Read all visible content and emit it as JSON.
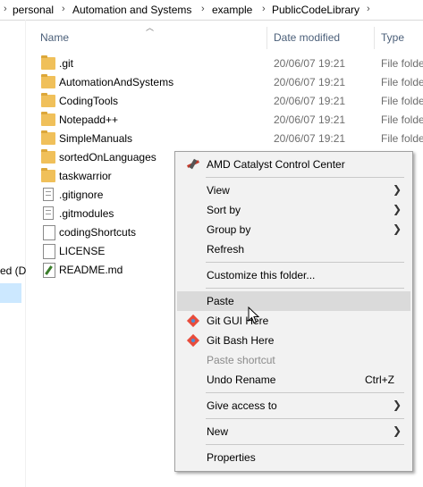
{
  "breadcrumb": {
    "items": [
      "personal",
      "Automation and Systems",
      "example",
      "PublicCodeLibrary"
    ]
  },
  "nav": {
    "fragment_text": "ed (D"
  },
  "columns": {
    "name": "Name",
    "date_modified": "Date modified",
    "type": "Type"
  },
  "files": [
    {
      "name": ".git",
      "date": "20/06/07 19:21",
      "type": "File folder",
      "kind": "folder"
    },
    {
      "name": "AutomationAndSystems",
      "date": "20/06/07 19:21",
      "type": "File folder",
      "kind": "folder"
    },
    {
      "name": "CodingTools",
      "date": "20/06/07 19:21",
      "type": "File folder",
      "kind": "folder"
    },
    {
      "name": "Notepadd++",
      "date": "20/06/07 19:21",
      "type": "File folder",
      "kind": "folder"
    },
    {
      "name": "SimpleManuals",
      "date": "20/06/07 19:21",
      "type": "File folder",
      "kind": "folder"
    },
    {
      "name": "sortedOnLanguages",
      "date": "",
      "type": "",
      "kind": "folder"
    },
    {
      "name": "taskwarrior",
      "date": "",
      "type": "",
      "kind": "folder"
    },
    {
      "name": ".gitignore",
      "date": "",
      "type": "",
      "kind": "text-file"
    },
    {
      "name": ".gitmodules",
      "date": "",
      "type": "",
      "kind": "text-file"
    },
    {
      "name": "codingShortcuts",
      "date": "",
      "type": "",
      "kind": "file"
    },
    {
      "name": "LICENSE",
      "date": "",
      "type": "",
      "kind": "file"
    },
    {
      "name": "README.md",
      "date": "",
      "type": "",
      "kind": "markdown-file"
    }
  ],
  "context_menu": {
    "items": [
      {
        "label": "AMD Catalyst Control Center",
        "icon": "amd-icon"
      },
      {
        "label": "View",
        "submenu": true
      },
      {
        "label": "Sort by",
        "submenu": true
      },
      {
        "label": "Group by",
        "submenu": true
      },
      {
        "label": "Refresh"
      },
      {
        "label": "Customize this folder..."
      },
      {
        "label": "Paste",
        "highlighted": true
      },
      {
        "label": "Git GUI Here",
        "icon": "git-icon"
      },
      {
        "label": "Git Bash Here",
        "icon": "git-icon"
      },
      {
        "label": "Paste shortcut",
        "disabled": true
      },
      {
        "label": "Undo Rename",
        "shortcut": "Ctrl+Z"
      },
      {
        "label": "Give access to",
        "submenu": true
      },
      {
        "label": "New",
        "submenu": true
      },
      {
        "label": "Properties"
      }
    ]
  },
  "colors": {
    "header_text": "#4c607a",
    "folder": "#f0c05a",
    "menu_bg": "#f2f2f2",
    "menu_hover": "#dadada",
    "nav_selected": "#cce8ff"
  }
}
